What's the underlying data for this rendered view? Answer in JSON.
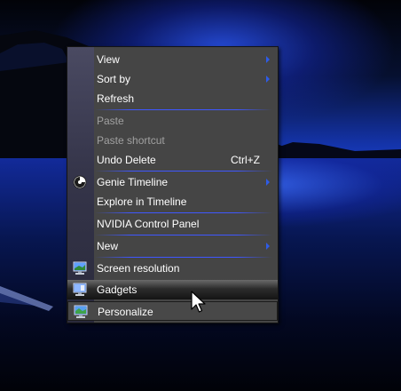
{
  "menu": {
    "items": [
      {
        "label": "View",
        "submenu": true
      },
      {
        "label": "Sort by",
        "submenu": true
      },
      {
        "label": "Refresh"
      },
      {
        "label": "Paste",
        "disabled": true
      },
      {
        "label": "Paste shortcut",
        "disabled": true
      },
      {
        "label": "Undo Delete",
        "shortcut": "Ctrl+Z"
      },
      {
        "label": "Genie Timeline",
        "submenu": true,
        "icon": "genie-timeline-icon"
      },
      {
        "label": "Explore in Timeline"
      },
      {
        "label": "NVIDIA Control Panel"
      },
      {
        "label": "New",
        "submenu": true
      },
      {
        "label": "Screen resolution",
        "icon": "monitor-icon"
      },
      {
        "label": "Gadgets",
        "icon": "gadgets-monitor-icon",
        "highlighted": true
      },
      {
        "label": "Personalize",
        "icon": "personalize-monitor-icon"
      }
    ]
  },
  "colors": {
    "menu_bg": "#454545",
    "separator": "#3f57ff",
    "submenu_arrow": "#2e5ce8",
    "disabled_text": "#a0a0a0"
  }
}
